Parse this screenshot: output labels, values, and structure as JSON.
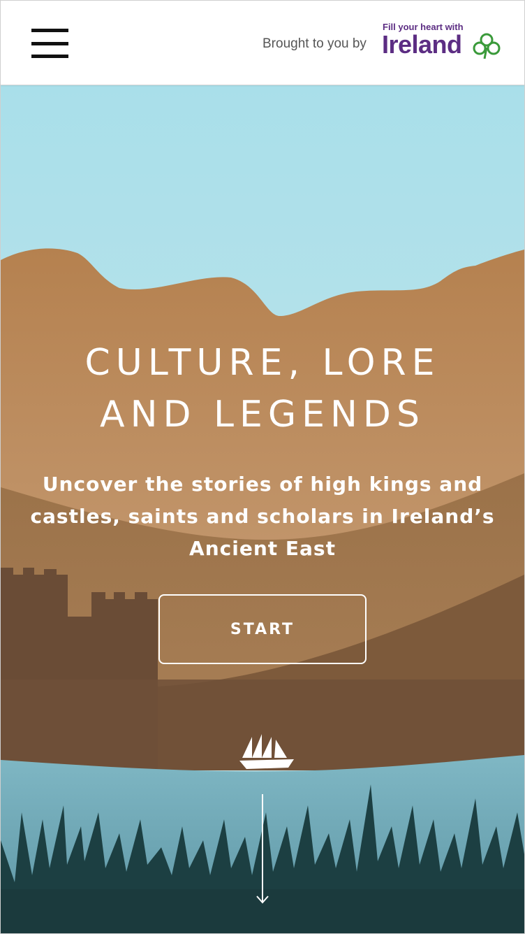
{
  "header": {
    "menu_icon": "hamburger-menu-icon",
    "brought_by": "Brought to you by",
    "brand_tagline": "Fill your heart with",
    "brand_name": "Ireland",
    "brand_icon": "shamrock-icon"
  },
  "hero": {
    "title_line1": "CULTURE, LORE",
    "title_line2": "AND LEGENDS",
    "subtitle": "Uncover the stories of high kings and castles, saints and scholars in Ireland’s Ancient East",
    "start_label": "START",
    "ship_icon": "sailing-ship-icon",
    "scroll_icon": "scroll-down-arrow-icon"
  },
  "colors": {
    "brand_purple": "#5c2d83",
    "shamrock_green": "#3a9a3a",
    "sky": "#b7e1ea",
    "mountain": "#b98859",
    "water": "#6ea7b6",
    "grass": "#1b3d3f"
  }
}
